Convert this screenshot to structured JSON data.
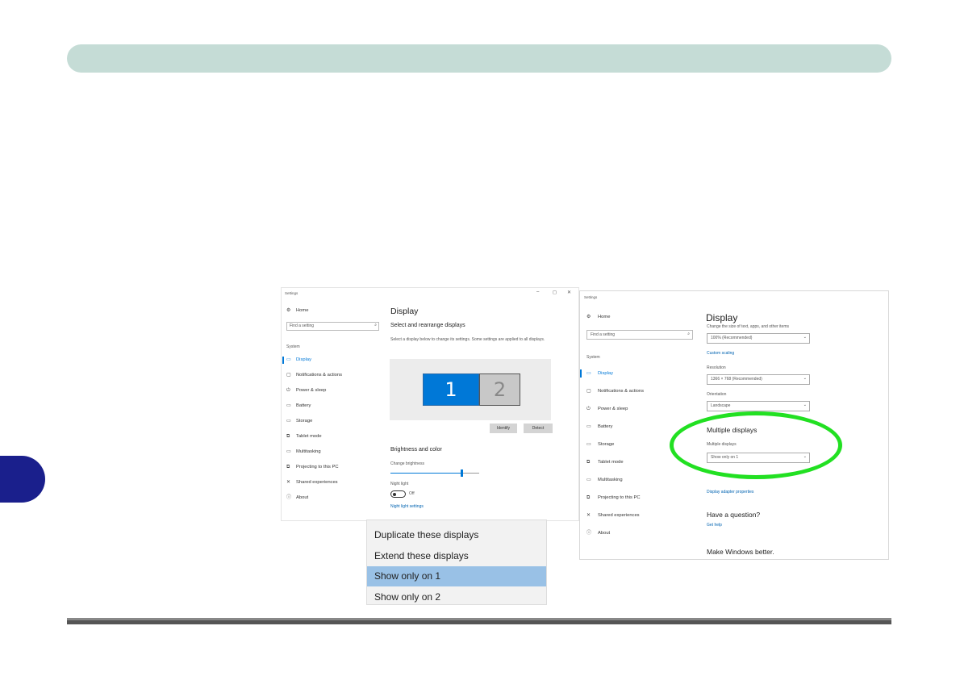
{
  "window1": {
    "title": "Settings",
    "controls": [
      "–",
      "◻",
      "✕"
    ],
    "home": "Home",
    "search_placeholder": "Find a setting",
    "section": "System",
    "nav": [
      "Display",
      "Notifications & actions",
      "Power & sleep",
      "Battery",
      "Storage",
      "Tablet mode",
      "Multitasking",
      "Projecting to this PC",
      "Shared experiences",
      "About"
    ],
    "heading": "Display",
    "subheading": "Select and rearrange displays",
    "description": "Select a display below to change its settings. Some settings are applied to all displays.",
    "monitor1": "1",
    "monitor2": "2",
    "identify_button": "Identify",
    "detect_button": "Detect",
    "brightness_heading": "Brightness and color",
    "brightness_label": "Change brightness",
    "brightness_level": 0.8,
    "night_light_label": "Night light",
    "night_light_state": "Off",
    "night_light_link": "Night light settings"
  },
  "dropdown": {
    "options": [
      "Duplicate these displays",
      "Extend these displays",
      "Show only on 1",
      "Show only on 2"
    ],
    "selected": "Show only on 1"
  },
  "window2": {
    "title": "Settings",
    "home": "Home",
    "search_placeholder": "Find a setting",
    "section": "System",
    "nav": [
      "Display",
      "Notifications & actions",
      "Power & sleep",
      "Battery",
      "Storage",
      "Tablet mode",
      "Multitasking",
      "Projecting to this PC",
      "Shared experiences",
      "About"
    ],
    "heading": "Display",
    "scale_label": "Change the size of text, apps, and other items",
    "scale_value": "100% (Recommended)",
    "custom_scaling_link": "Custom scaling",
    "resolution_label": "Resolution",
    "resolution_value": "1366 × 768 (Recommended)",
    "orientation_label": "Orientation",
    "orientation_value": "Landscape",
    "multiple_heading": "Multiple displays",
    "multiple_label": "Multiple displays",
    "multiple_value": "Show only on 1",
    "adapter_link": "Display adapter properties",
    "question_heading": "Have a question?",
    "help_link": "Get help",
    "better_heading": "Make Windows better."
  },
  "colors": {
    "top_bar": "#c5dcd6",
    "side_tab": "#1a1f8c",
    "highlight_ellipse": "#22e022",
    "monitor_selected": "#0078d7",
    "dropdown_highlight": "#99c1e6"
  }
}
